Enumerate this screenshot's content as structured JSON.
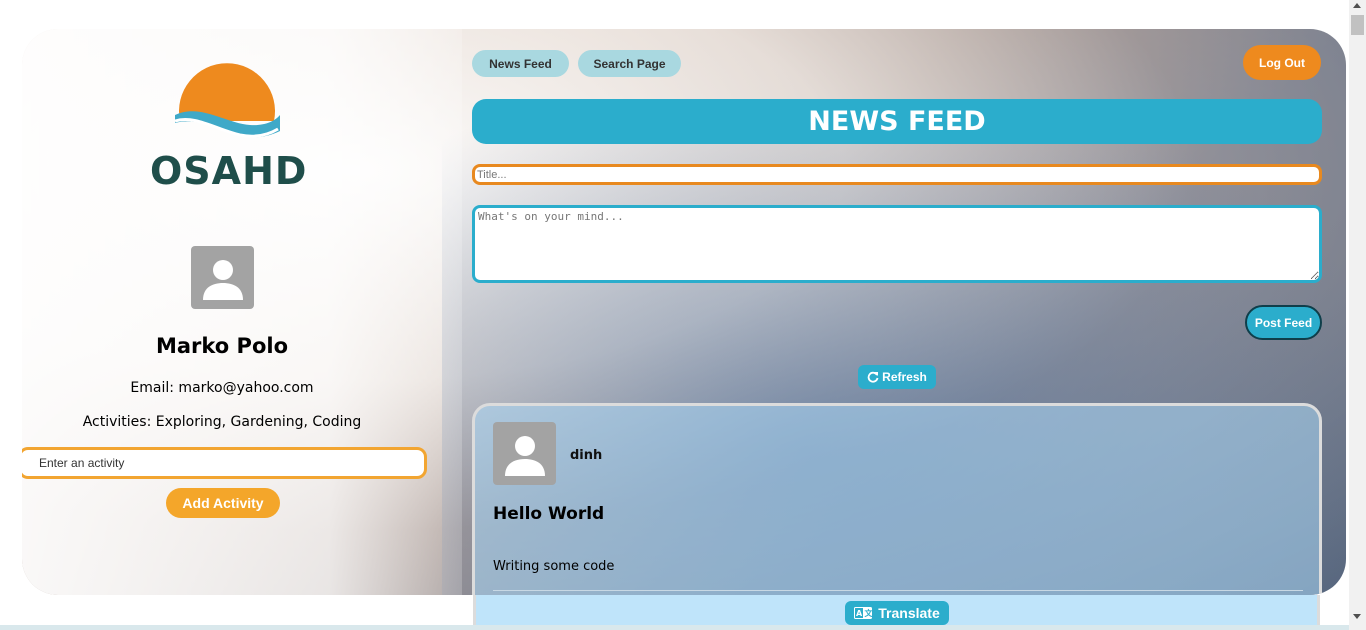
{
  "profile": {
    "logo_text": "OSAHD",
    "name": "Marko Polo",
    "email_line": "Email: marko@yahoo.com",
    "activities_line": "Activities: Exploring, Gardening, Coding",
    "activity_placeholder": "Enter an activity",
    "add_activity_label": "Add Activity"
  },
  "nav": {
    "news_feed_label": "News Feed",
    "search_page_label": "Search Page",
    "logout_label": "Log Out"
  },
  "feed": {
    "banner_title": "NEWS FEED",
    "title_placeholder": "Title...",
    "body_placeholder": "What's on your mind...",
    "post_button_label": "Post Feed",
    "refresh_label": "Refresh"
  },
  "posts": [
    {
      "author": "dinh",
      "title": "Hello World",
      "body": "Writing some code",
      "translate_label": "Translate"
    }
  ],
  "colors": {
    "accent_blue": "#2badcc",
    "accent_orange": "#ee8a1e",
    "logo_teal": "#1f4e4a"
  },
  "icons": {
    "logo": "sun-wave-logo",
    "avatar": "user-silhouette-icon",
    "refresh": "refresh-icon",
    "translate": "translate-icon"
  }
}
